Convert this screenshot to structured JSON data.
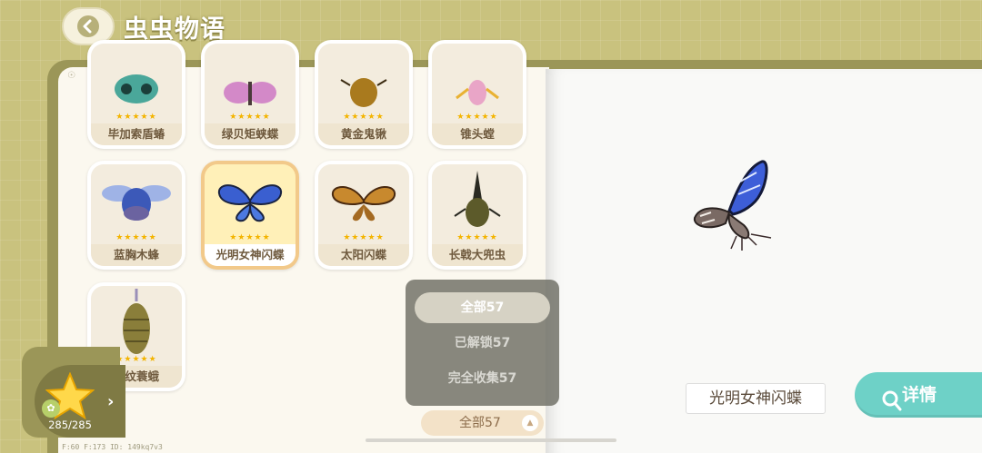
{
  "header": {
    "title": "虫虫物语"
  },
  "collection": {
    "cards": [
      {
        "name": "毕加索盾蝽",
        "stars": "★★★★★"
      },
      {
        "name": "绿贝矩蛱蝶",
        "stars": "★★★★★"
      },
      {
        "name": "黄金鬼锹",
        "stars": "★★★★★"
      },
      {
        "name": "锥头螳",
        "stars": "★★★★★"
      },
      {
        "name": "蓝胸木蜂",
        "stars": "★★★★★"
      },
      {
        "name": "光明女神闪蝶",
        "stars": "★★★★★"
      },
      {
        "name": "太阳闪蝶",
        "stars": "★★★★★"
      },
      {
        "name": "长戟大兜虫",
        "stars": "★★★★★"
      },
      {
        "name": "螺纹蓑蛾",
        "stars": "★★★★★"
      }
    ],
    "selected_index": 5
  },
  "filter": {
    "options": [
      "全部57",
      "已解锁57",
      "完全收集57"
    ],
    "current": "全部57"
  },
  "detail": {
    "bug_name": "光明女神闪蝶",
    "detail_label": "详情"
  },
  "stars_panel": {
    "count": "285/285"
  },
  "debug": {
    "text": "F:60   F:173   ID: 149kq7v3"
  },
  "colors": {
    "accent_teal": "#6ed1c7",
    "book_olive": "#9b9658",
    "star_yellow": "#f3b400"
  }
}
